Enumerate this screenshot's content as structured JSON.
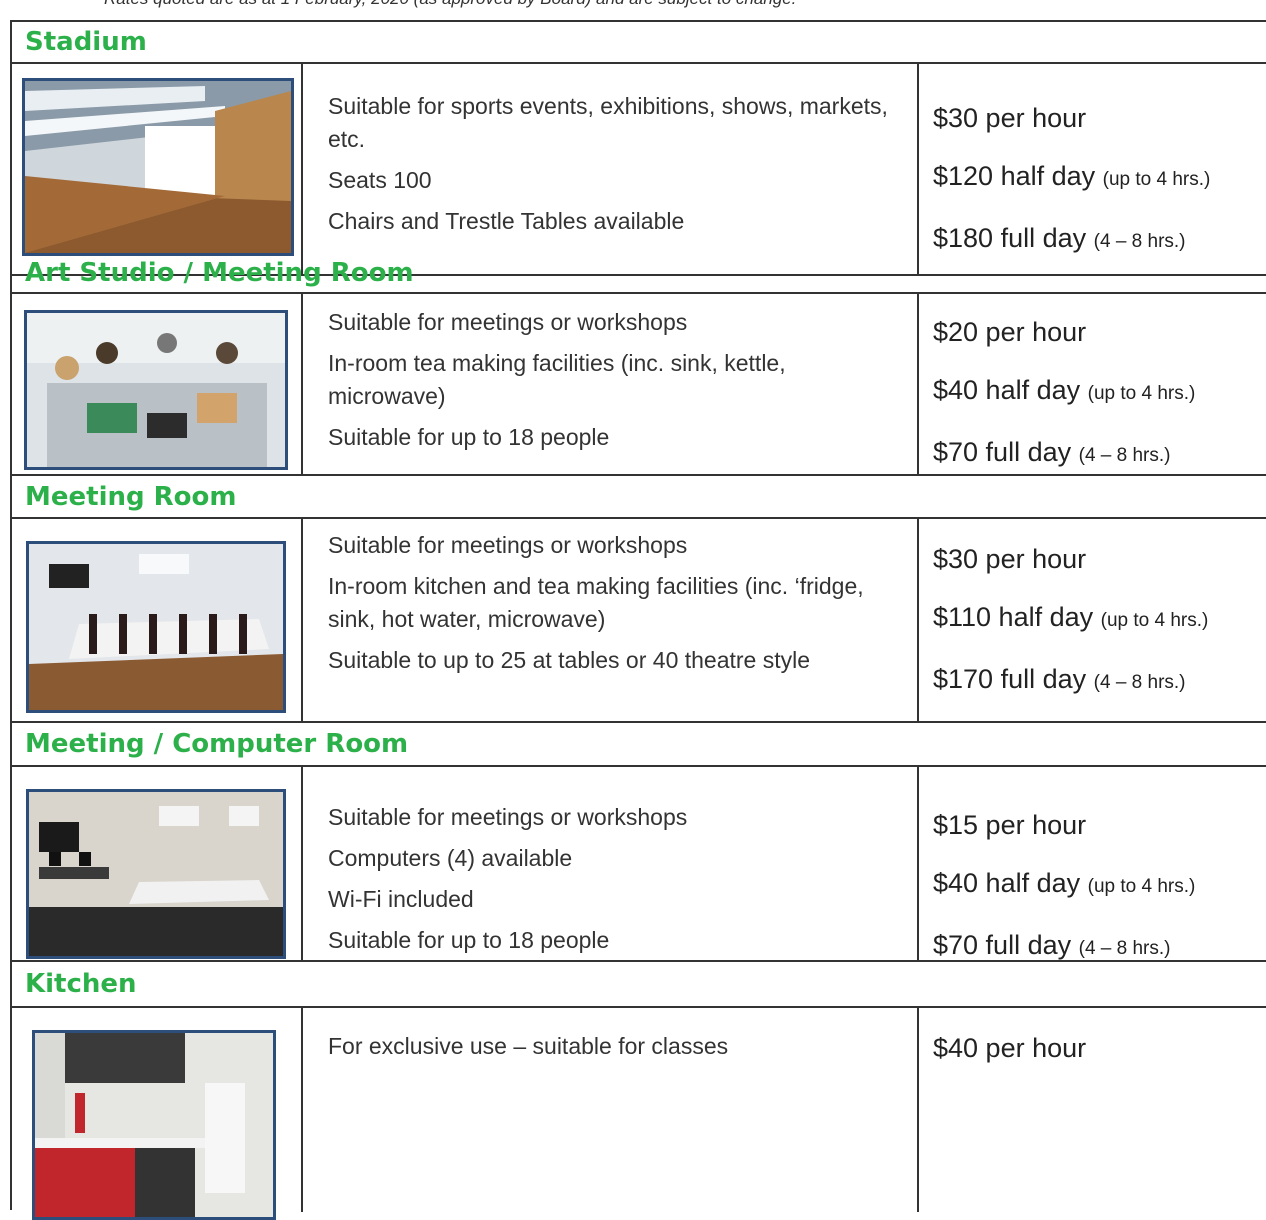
{
  "note": "Rates quoted are as at 1 February, 2020 (as approved by Board) and are subject to change.",
  "sections": [
    {
      "title": "Stadium",
      "description": [
        "Suitable for sports events, exhibitions, shows, markets, etc.",
        "Seats 100",
        "Chairs and Trestle Tables available"
      ],
      "rates": [
        {
          "main": "$30 per hour",
          "detail": ""
        },
        {
          "main": "$120 half day",
          "detail": "(up to 4 hrs.)"
        },
        {
          "main": "$180 full day",
          "detail": "(4 – 8 hrs.)"
        }
      ]
    },
    {
      "title": "Art Studio / Meeting Room",
      "description": [
        "Suitable for meetings or workshops",
        "In-room tea making facilities (inc. sink, kettle, microwave)",
        "Suitable for up to 18 people"
      ],
      "rates": [
        {
          "main": "$20 per hour",
          "detail": ""
        },
        {
          "main": "$40 half day",
          "detail": "(up to 4 hrs.)"
        },
        {
          "main": "$70 full day",
          "detail": "(4 – 8 hrs.)"
        }
      ]
    },
    {
      "title": "Meeting Room",
      "description": [
        "Suitable for meetings or workshops",
        "In-room kitchen and tea making facilities (inc. ‘fridge, sink, hot water, microwave)",
        "Suitable to up to 25 at tables or 40 theatre style"
      ],
      "rates": [
        {
          "main": "$30 per hour",
          "detail": ""
        },
        {
          "main": "$110 half day",
          "detail": "(up to 4 hrs.)"
        },
        {
          "main": "$170 full day",
          "detail": "(4 – 8 hrs.)"
        }
      ]
    },
    {
      "title": "Meeting / Computer Room",
      "description": [
        "Suitable for meetings or workshops",
        "Computers (4) available",
        "Wi-Fi included",
        "Suitable for up to 18 people"
      ],
      "rates": [
        {
          "main": "$15 per hour",
          "detail": ""
        },
        {
          "main": "$40 half day",
          "detail": "(up to 4 hrs.)"
        },
        {
          "main": "$70 full day",
          "detail": "(4 – 8 hrs.)"
        }
      ]
    },
    {
      "title": "Kitchen",
      "description": [
        "For exclusive use – suitable for classes"
      ],
      "rates": [
        {
          "main": "$40 per hour",
          "detail": ""
        }
      ]
    }
  ]
}
